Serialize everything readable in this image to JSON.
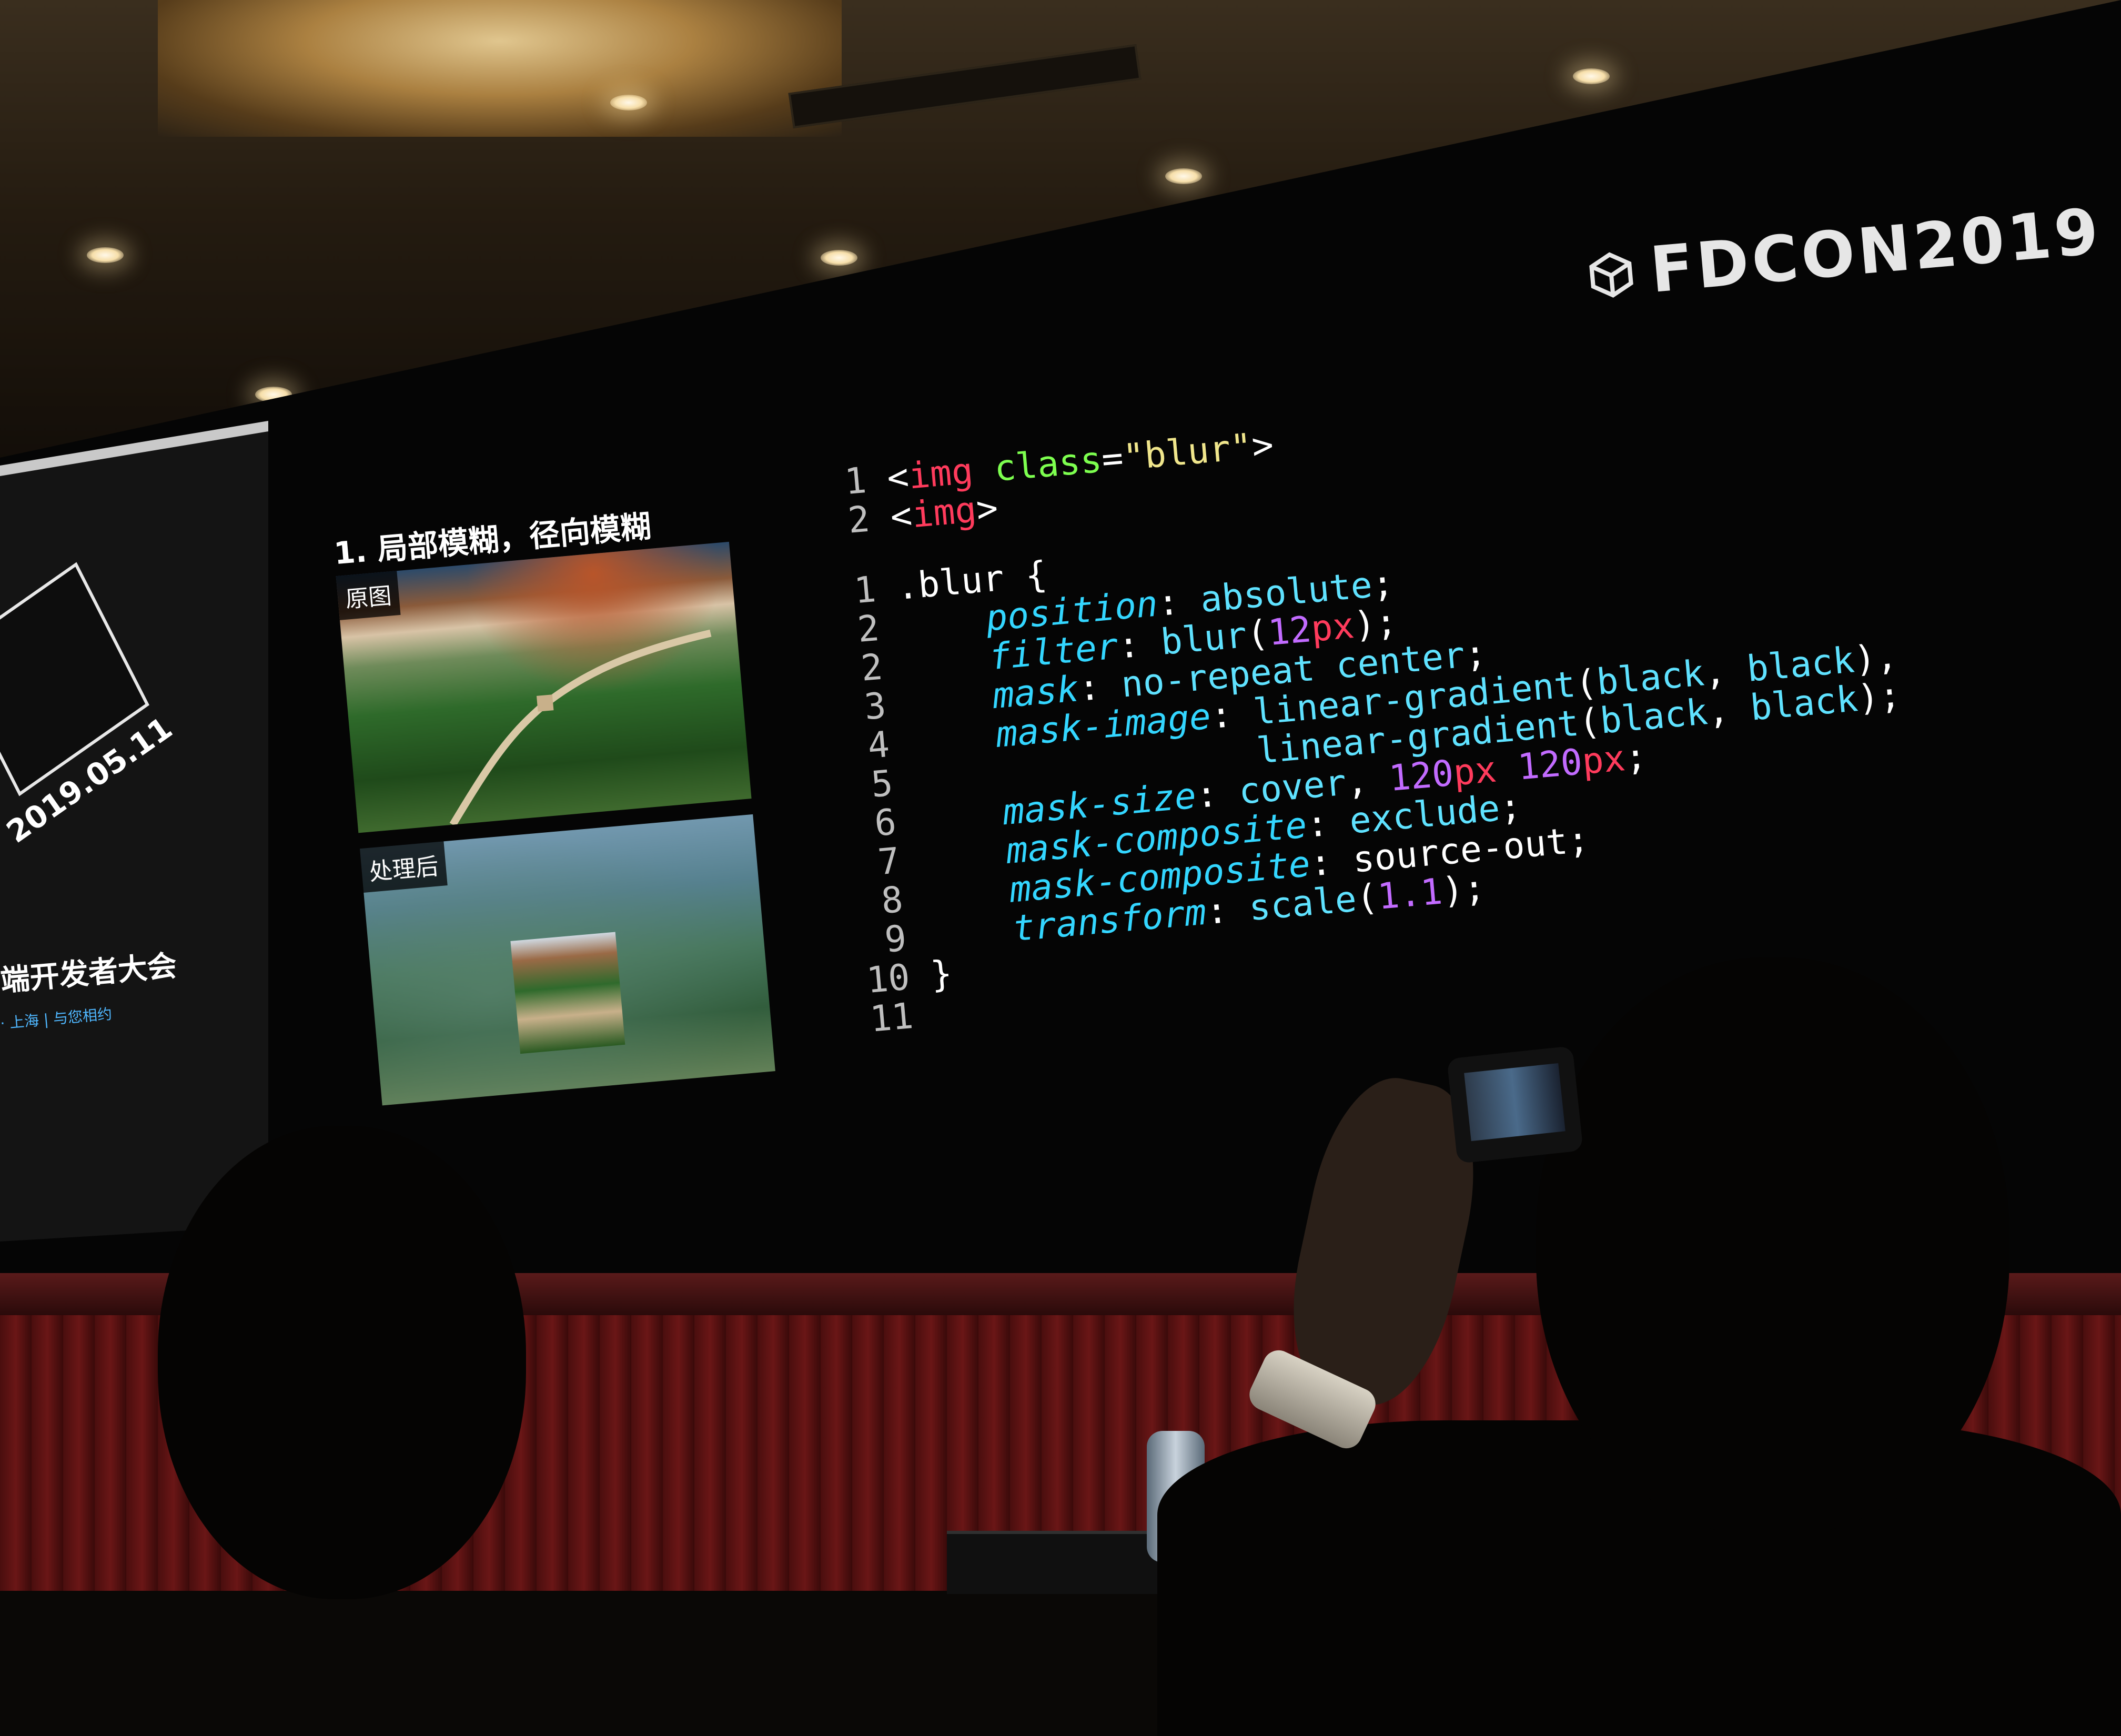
{
  "brand": {
    "name": "FDCON2019"
  },
  "side_screen": {
    "date": "2019.05.11",
    "title": "端开发者大会",
    "subtitle": "· 上海 | 与您相约"
  },
  "slide": {
    "heading": "1. 局部模糊，径向模糊",
    "photo_original_label": "原图",
    "photo_processed_label": "处理后"
  },
  "code": {
    "html_lines": [
      {
        "ln": "1",
        "tokens": [
          [
            "t-punc",
            "<"
          ],
          [
            "t-tag",
            "img"
          ],
          [
            "t-punc",
            " "
          ],
          [
            "t-attr",
            "class"
          ],
          [
            "t-punc",
            "="
          ],
          [
            "t-str",
            "\"blur\""
          ],
          [
            "t-punc",
            ">"
          ]
        ]
      },
      {
        "ln": "2",
        "tokens": [
          [
            "t-punc",
            "<"
          ],
          [
            "t-tag",
            "img"
          ],
          [
            "t-punc",
            ">"
          ]
        ]
      }
    ],
    "css_lines": [
      {
        "ln": "1",
        "tokens": [
          [
            "t-sel",
            ".blur "
          ],
          [
            "t-punc",
            "{"
          ]
        ]
      },
      {
        "ln": "2",
        "tokens": [
          [
            "t-punc",
            "    "
          ],
          [
            "t-prop",
            "position"
          ],
          [
            "t-punc",
            ": "
          ],
          [
            "t-val",
            "absolute"
          ],
          [
            "t-punc",
            ";"
          ]
        ]
      },
      {
        "ln": "2",
        "tokens": [
          [
            "t-punc",
            "    "
          ],
          [
            "t-prop",
            "filter"
          ],
          [
            "t-punc",
            ": "
          ],
          [
            "t-val",
            "blur"
          ],
          [
            "t-punc",
            "("
          ],
          [
            "t-num",
            "12"
          ],
          [
            "t-unit",
            "px"
          ],
          [
            "t-punc",
            ");"
          ]
        ]
      },
      {
        "ln": "3",
        "tokens": [
          [
            "t-punc",
            "    "
          ],
          [
            "t-prop",
            "mask"
          ],
          [
            "t-punc",
            ": "
          ],
          [
            "t-val",
            "no-repeat center"
          ],
          [
            "t-punc",
            ";"
          ]
        ]
      },
      {
        "ln": "4",
        "tokens": [
          [
            "t-punc",
            "    "
          ],
          [
            "t-prop",
            "mask-image"
          ],
          [
            "t-punc",
            ": "
          ],
          [
            "t-val",
            "linear-gradient"
          ],
          [
            "t-punc",
            "("
          ],
          [
            "t-val",
            "black"
          ],
          [
            "t-punc",
            ", "
          ],
          [
            "t-val",
            "black"
          ],
          [
            "t-punc",
            "),"
          ]
        ]
      },
      {
        "ln": "5",
        "tokens": [
          [
            "t-punc",
            "                "
          ],
          [
            "t-val",
            "linear-gradient"
          ],
          [
            "t-punc",
            "("
          ],
          [
            "t-val",
            "black"
          ],
          [
            "t-punc",
            ", "
          ],
          [
            "t-val",
            "black"
          ],
          [
            "t-punc",
            ");"
          ]
        ]
      },
      {
        "ln": "6",
        "tokens": [
          [
            "t-punc",
            "    "
          ],
          [
            "t-prop",
            "mask-size"
          ],
          [
            "t-punc",
            ": "
          ],
          [
            "t-val",
            "cover"
          ],
          [
            "t-punc",
            ", "
          ],
          [
            "t-num",
            "120"
          ],
          [
            "t-unit",
            "px"
          ],
          [
            "t-punc",
            " "
          ],
          [
            "t-num",
            "120"
          ],
          [
            "t-unit",
            "px"
          ],
          [
            "t-punc",
            ";"
          ]
        ]
      },
      {
        "ln": "7",
        "tokens": [
          [
            "t-punc",
            "    "
          ],
          [
            "t-prop",
            "mask-composite"
          ],
          [
            "t-punc",
            ": "
          ],
          [
            "t-val",
            "exclude"
          ],
          [
            "t-punc",
            ";"
          ]
        ]
      },
      {
        "ln": "8",
        "tokens": [
          [
            "t-punc",
            "    "
          ],
          [
            "t-prop",
            "mask-composite"
          ],
          [
            "t-punc",
            ": "
          ],
          [
            "t-punc",
            "source-out;"
          ]
        ]
      },
      {
        "ln": "9",
        "tokens": [
          [
            "t-punc",
            "    "
          ],
          [
            "t-prop",
            "transform"
          ],
          [
            "t-punc",
            ": "
          ],
          [
            "t-val",
            "scale"
          ],
          [
            "t-punc",
            "("
          ],
          [
            "t-num",
            "1.1"
          ],
          [
            "t-punc",
            ");"
          ]
        ]
      },
      {
        "ln": "10",
        "tokens": [
          [
            "t-punc",
            "}"
          ]
        ]
      },
      {
        "ln": "11",
        "tokens": []
      }
    ]
  },
  "colors": {
    "tag": "#ff3b5c",
    "attr": "#7dff4f",
    "string": "#f0e68c",
    "property": "#33d6ff",
    "number": "#c26bff"
  }
}
